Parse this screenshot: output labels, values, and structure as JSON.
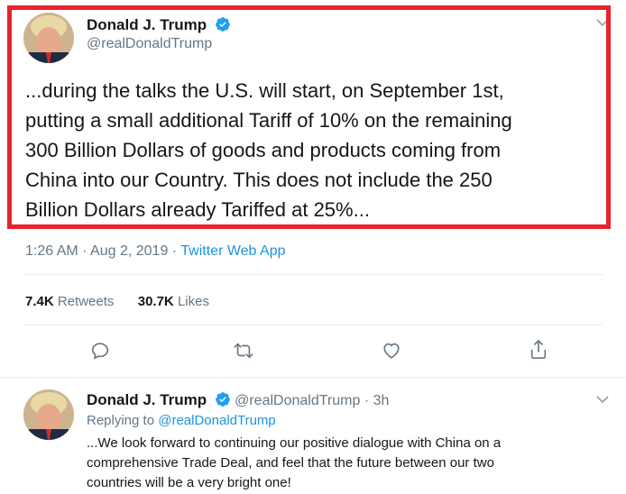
{
  "main_tweet": {
    "name": "Donald J. Trump",
    "handle": "@realDonaldTrump",
    "text_lines": [
      "...during the talks the U.S. will start, on September 1st,",
      "putting a small additional Tariff of 10% on the remaining",
      "300 Billion Dollars of goods and products coming from",
      "China into our Country. This does not include the 250",
      "Billion Dollars already Tariffed at 25%..."
    ],
    "time": "1:26 AM",
    "date": "Aug 2, 2019",
    "separator": "·",
    "source": "Twitter Web App",
    "retweets_count": "7.4K",
    "retweets_label": "Retweets",
    "likes_count": "30.7K",
    "likes_label": "Likes"
  },
  "reply_tweet": {
    "name": "Donald J. Trump",
    "handle": "@realDonaldTrump",
    "separator": "·",
    "age": "3h",
    "replying_prefix": "Replying to",
    "replying_handle": "@realDonaldTrump",
    "text_lines": [
      "...We look forward to continuing our positive dialogue with China on a",
      "comprehensive Trade Deal, and feel that the future between our two",
      "countries will be a very bright one!"
    ]
  },
  "icons": {
    "verified": "verified-badge-icon",
    "reply": "reply-icon",
    "retweet": "retweet-icon",
    "like": "heart-icon",
    "share": "share-icon",
    "menu": "chevron-down-icon"
  },
  "colors": {
    "highlight": "#e8232f",
    "link": "#1b95e0",
    "verified": "#1da1f2",
    "muted": "#657786",
    "text": "#14171a"
  }
}
